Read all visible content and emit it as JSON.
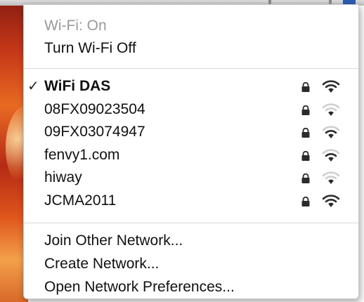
{
  "desktop": {
    "accent": "#2a5db0"
  },
  "menu": {
    "status": "Wi-Fi: On",
    "toggle": "Turn Wi-Fi Off",
    "check_mark": "✓",
    "networks": [
      {
        "name": "WiFi DAS",
        "selected": true,
        "locked": true,
        "signal_bars": 3
      },
      {
        "name": "08FX09023504",
        "selected": false,
        "locked": true,
        "signal_bars": 1
      },
      {
        "name": "09FX03074947",
        "selected": false,
        "locked": true,
        "signal_bars": 2
      },
      {
        "name": "fenvy1.com",
        "selected": false,
        "locked": true,
        "signal_bars": 2
      },
      {
        "name": "hiway",
        "selected": false,
        "locked": true,
        "signal_bars": 1
      },
      {
        "name": "JCMA2011",
        "selected": false,
        "locked": true,
        "signal_bars": 3
      }
    ],
    "actions": {
      "join_other": "Join Other Network...",
      "create": "Create Network...",
      "preferences": "Open Network Preferences..."
    },
    "icons": {
      "lock": "lock-icon",
      "wifi": "wifi-signal-icon",
      "check": "checkmark-icon"
    },
    "colors": {
      "active_bar": "#2b2b2b",
      "inactive_bar": "#cfcfcf"
    }
  }
}
